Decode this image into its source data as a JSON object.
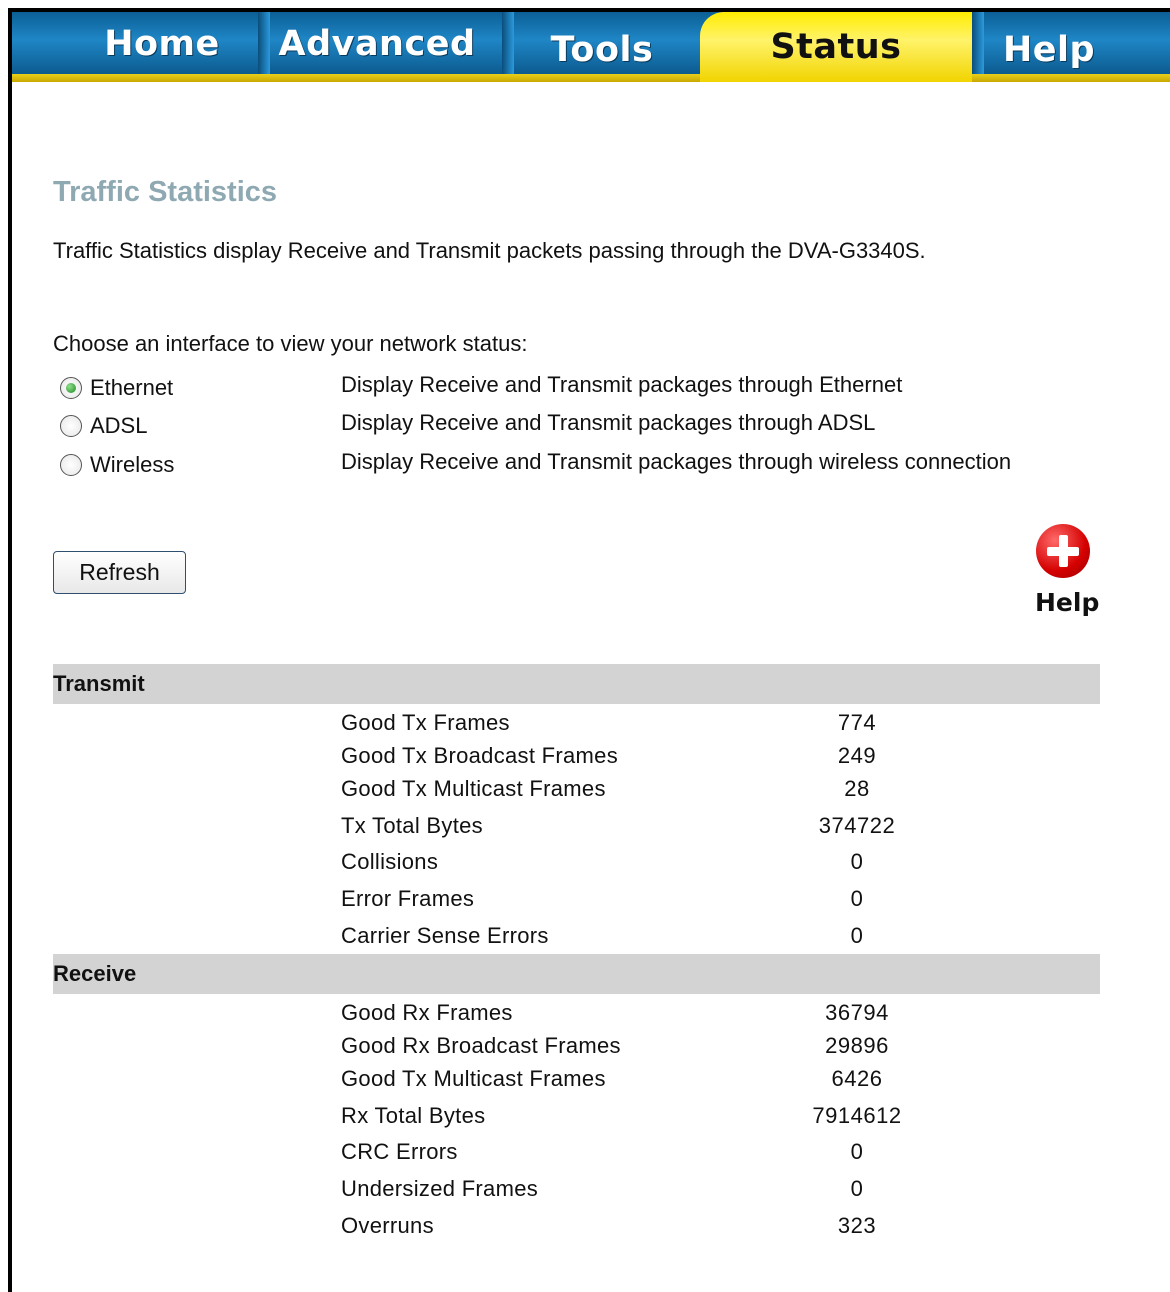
{
  "nav": {
    "tabs": [
      {
        "label": "Home"
      },
      {
        "label": "Advanced"
      },
      {
        "label": "Tools"
      },
      {
        "label": "Status"
      },
      {
        "label": "Help"
      }
    ],
    "active_tab": "Status"
  },
  "page": {
    "title": "Traffic Statistics",
    "description": "Traffic Statistics display Receive and Transmit packets passing through the DVA-G3340S.",
    "choose_label": "Choose an interface to view your network status:"
  },
  "interfaces": [
    {
      "label": "Ethernet",
      "selected": true,
      "description": "Display Receive and Transmit packages through Ethernet"
    },
    {
      "label": "ADSL",
      "selected": false,
      "description": "Display Receive and Transmit packages through ADSL"
    },
    {
      "label": "Wireless",
      "selected": false,
      "description": "Display Receive and Transmit packages through wireless connection"
    }
  ],
  "actions": {
    "refresh_label": "Refresh",
    "help_label": "Help"
  },
  "transmit": {
    "header": "Transmit",
    "rows": [
      {
        "label": "Good Tx Frames",
        "value": "774"
      },
      {
        "label": "Good Tx Broadcast Frames",
        "value": "249"
      },
      {
        "label": "Good Tx Multicast Frames",
        "value": "28"
      },
      {
        "label": "Tx Total Bytes",
        "value": "374722"
      },
      {
        "label": "Collisions",
        "value": "0"
      },
      {
        "label": "Error Frames",
        "value": "0"
      },
      {
        "label": "Carrier Sense Errors",
        "value": "0"
      }
    ]
  },
  "receive": {
    "header": "Receive",
    "rows": [
      {
        "label": "Good Rx Frames",
        "value": "36794"
      },
      {
        "label": "Good Rx Broadcast Frames",
        "value": "29896"
      },
      {
        "label": "Good Tx Multicast Frames",
        "value": "6426"
      },
      {
        "label": "Rx Total Bytes",
        "value": "7914612"
      },
      {
        "label": "CRC Errors",
        "value": "0"
      },
      {
        "label": "Undersized Frames",
        "value": "0"
      },
      {
        "label": "Overruns",
        "value": "323"
      }
    ]
  },
  "colors": {
    "tab_blue": "#1f86c6",
    "tab_active_yellow": "#ffec00",
    "title": "#8fa9b3",
    "section_bar": "#d3d3d3",
    "help_red": "#d40000"
  }
}
